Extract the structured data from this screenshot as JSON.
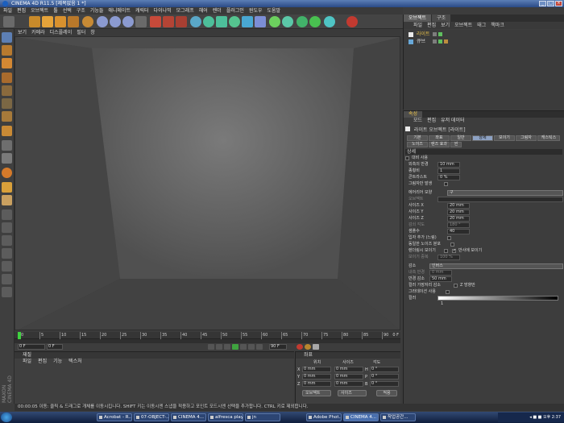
{
  "window": {
    "title": "CINEMA 4D R11.5 [제목없음 1 *]",
    "minimize": "_",
    "maximize": "□",
    "close": "×"
  },
  "menubar": [
    "파일",
    "편집",
    "오브젝트",
    "툴",
    "선택",
    "구조",
    "기능들",
    "애니메이트",
    "캐릭터",
    "다이나믹",
    "모그래프",
    "헤어",
    "렌더",
    "플러그인",
    "윈도우",
    "도움말"
  ],
  "viewport": {
    "menu": [
      "보기",
      "카메라",
      "디스플레이",
      "필터",
      "창"
    ]
  },
  "timeline": {
    "ticks": [
      "0",
      "5",
      "10",
      "15",
      "20",
      "25",
      "30",
      "35",
      "40",
      "45",
      "50",
      "55",
      "60",
      "65",
      "70",
      "75",
      "80",
      "85",
      "90"
    ],
    "end_label": "0 F",
    "current_frame": "0 F",
    "min_frame": "0 F",
    "max_frame": "90 F"
  },
  "materials": {
    "title": "재질",
    "menu": [
      "파일",
      "편집",
      "기능",
      "텍스처"
    ]
  },
  "coordinates": {
    "title": "좌표",
    "headers": {
      "position": "위치",
      "size": "사이즈",
      "rotation": "각도"
    },
    "rows": [
      {
        "axis": "X",
        "pos": "0 mm",
        "size": "0 mm",
        "rot_label": "H",
        "rot": "0 °"
      },
      {
        "axis": "Y",
        "pos": "0 mm",
        "size": "0 mm",
        "rot_label": "P",
        "rot": "0 °"
      },
      {
        "axis": "Z",
        "pos": "0 mm",
        "size": "0 mm",
        "rot_label": "B",
        "rot": "0 °"
      }
    ],
    "mode_select": "오브젝트",
    "size_select": "사이즈",
    "apply": "적용"
  },
  "statusbar": "00:00:05  이동: 클릭 & 드래그로 개체를 이동시킵니다. SHIFT 키는 이동시엔 스냅을 적용하고 포인트 모드시엔 선택을 추가합니다. CTRL 키로 제외합니다.",
  "objects": {
    "tabs": [
      "오브젝트",
      "구조"
    ],
    "menu": [
      "파일",
      "편집",
      "보기",
      "오브젝트",
      "태그",
      "책마크"
    ],
    "items": [
      {
        "name": "라이트",
        "color": "#e8c04a"
      },
      {
        "name": "큐브",
        "color": "#d8d8d8"
      }
    ]
  },
  "attributes": {
    "panel_tab": "속성",
    "menu": [
      "모드",
      "편집",
      "유저 데이터"
    ],
    "object_title": "라이트 오브젝트 [라이트]",
    "tabs_row1": [
      "기본",
      "좌표",
      "일반",
      "상세",
      "보이기",
      "그림자",
      "캐스틱스"
    ],
    "tabs_row2": [
      "노이즈",
      "렌즈 효과",
      "씬"
    ],
    "active_tab": "상세",
    "section": "상세",
    "props": [
      {
        "label": "대비 사용",
        "type": "check",
        "checked": false
      },
      {
        "label": "외측의 반경",
        "value": "10 mm"
      },
      {
        "label": "종횡비",
        "value": "1"
      },
      {
        "label": "콘트라스트",
        "value": "0 %"
      },
      {
        "label": "그림자만 발생",
        "type": "check",
        "checked": false
      },
      {
        "label": "에어리어 모양",
        "value": "구"
      },
      {
        "label": "오브젝트",
        "value": "",
        "dim": true
      },
      {
        "label": "사이즈 X",
        "value": "20 mm"
      },
      {
        "label": "사이즈 Y",
        "value": "20 mm"
      },
      {
        "label": "사이즈 Z",
        "value": "20 mm"
      },
      {
        "label": "감쇠 각도",
        "value": "180 °",
        "dim": true
      },
      {
        "label": "샘플수",
        "value": "40"
      },
      {
        "label": "입자 추가 (느림)",
        "type": "check",
        "checked": false
      },
      {
        "label": "렌더링시 보이기",
        "type": "check",
        "checked": false
      },
      {
        "label": "뷰포트에 보이기",
        "type": "check",
        "checked": true
      },
      {
        "label": "보이기 중복",
        "value": "100 %",
        "dim": true
      }
    ],
    "extra_checks": {
      "noise": "동일한 노이즈 분포",
      "reflect": "반사에 보이기"
    },
    "falloff": {
      "label": "감소",
      "value": "인버스"
    },
    "inner_radius": {
      "label": "내측 반경",
      "value": "0 mm"
    },
    "radius": {
      "label": "반경 감소",
      "value": "50 mm"
    },
    "clamp": {
      "label": "컬러 가장자리 감소",
      "value": "Z 방향만"
    },
    "gradient_check": "그라데이션 사용",
    "gradient_label": "컬러",
    "gradient_knob_value": "1"
  },
  "taskbar": {
    "tasks": [
      "Acrobat - R...",
      "07-OBJECT-...",
      "CINEMA 4...",
      "alfresca play...",
      "jn",
      "Adobe Phot...",
      "CINEMA 4...",
      "작업공간..."
    ],
    "active_task_index": 6,
    "tray": "◂ ■ ■ 오후 2:37"
  }
}
